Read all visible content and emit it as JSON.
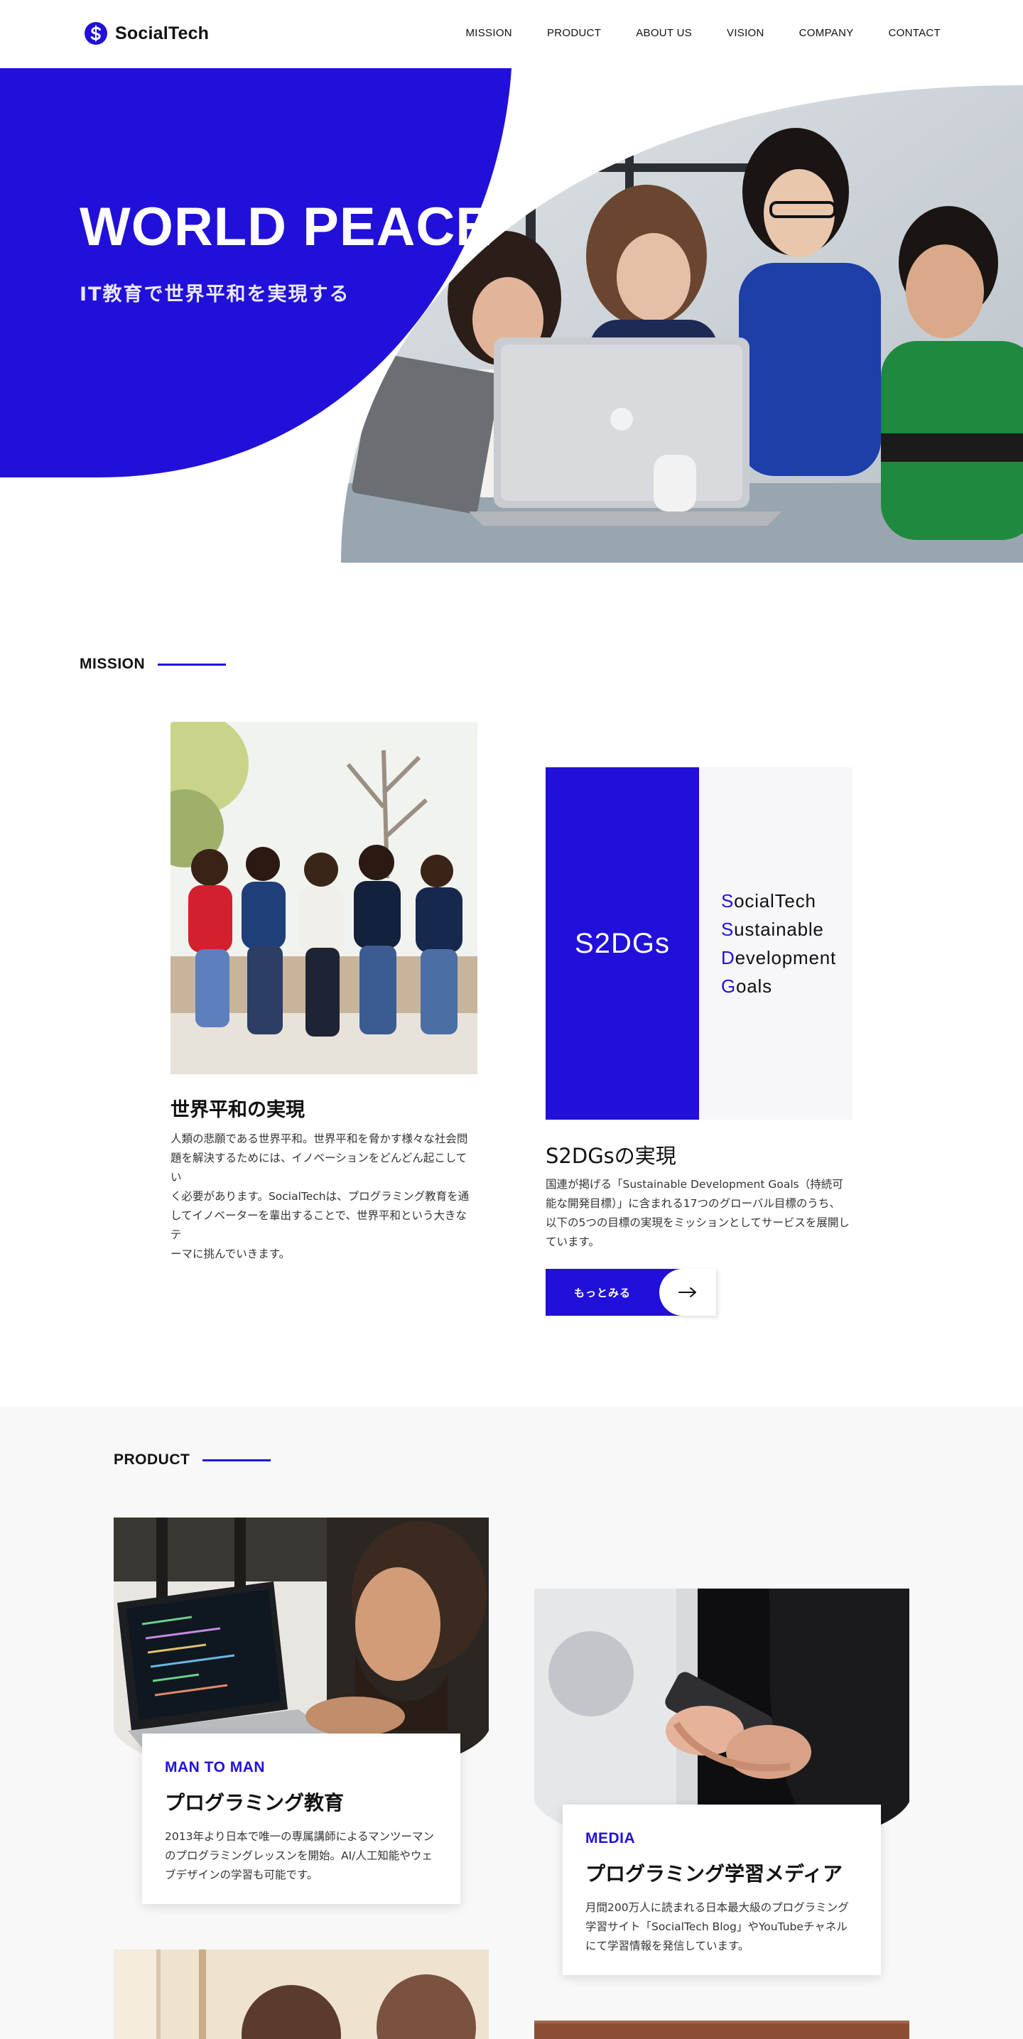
{
  "brand": {
    "name": "SocialTech",
    "accent": "#2110d9",
    "logo_icon": "s-coin-logo-icon"
  },
  "nav": {
    "items": [
      {
        "label": "MISSION"
      },
      {
        "label": "PRODUCT"
      },
      {
        "label": "ABOUT US"
      },
      {
        "label": "VISION"
      },
      {
        "label": "COMPANY"
      },
      {
        "label": "CONTACT"
      }
    ]
  },
  "hero": {
    "title": "WORLD PEACE",
    "subtitle": "IT教育で世界平和を実現する",
    "image": "team-around-laptop-photo"
  },
  "mission": {
    "heading": "MISSION",
    "left": {
      "image": "friends-on-bench-photo",
      "title": "世界平和の実現",
      "text_lines": [
        "人類の悲願である世界平和。世界平和を脅かす様々な社会問",
        "題を解決するためには、イノベーションをどんどん起こしてい",
        "く必要があります。SocialTechは、プログラミング教育を通",
        "してイノベーターを輩出することで、世界平和という大きなテ",
        "ーマに挑んでいきます。"
      ]
    },
    "right": {
      "badge": "S2DGs",
      "list": [
        {
          "initial": "S",
          "rest": "ocialTech"
        },
        {
          "initial": "S",
          "rest": "ustainable"
        },
        {
          "initial": "D",
          "rest": "evelopment"
        },
        {
          "initial": "G",
          "rest": "oals"
        }
      ],
      "title": "S2DGsの実現",
      "text_lines": [
        "国連が掲げる「Sustainable Development Goals（持続可",
        "能な開発目標）」に含まれる17つのグローバル目標のうち、",
        "以下の5つの目標の実現をミッションとしてサービスを展開し",
        "ています。"
      ],
      "button_label": "もっとみる",
      "button_icon": "arrow-right-icon"
    }
  },
  "product": {
    "heading": "PRODUCT",
    "cards": [
      {
        "image": "programmer-at-laptop-photo",
        "tag": "MAN TO MAN",
        "title": "プログラミング教育",
        "text_lines": [
          "2013年より日本で唯一の専属講師によるマンツーマン",
          "のプログラミングレッスンを開始。AI/人工知能やウェ",
          "ブデザインの学習も可能です。"
        ]
      },
      {
        "image": "hands-with-smartphone-photo",
        "tag": "MEDIA",
        "title": "プログラミング学習メディア",
        "text_lines": [
          "月間200万人に読まれる日本最大級のプログラミング",
          "学習サイト「SocialTech Blog」やYouTubeチャネル",
          "にて学習情報を発信しています。"
        ]
      }
    ]
  }
}
